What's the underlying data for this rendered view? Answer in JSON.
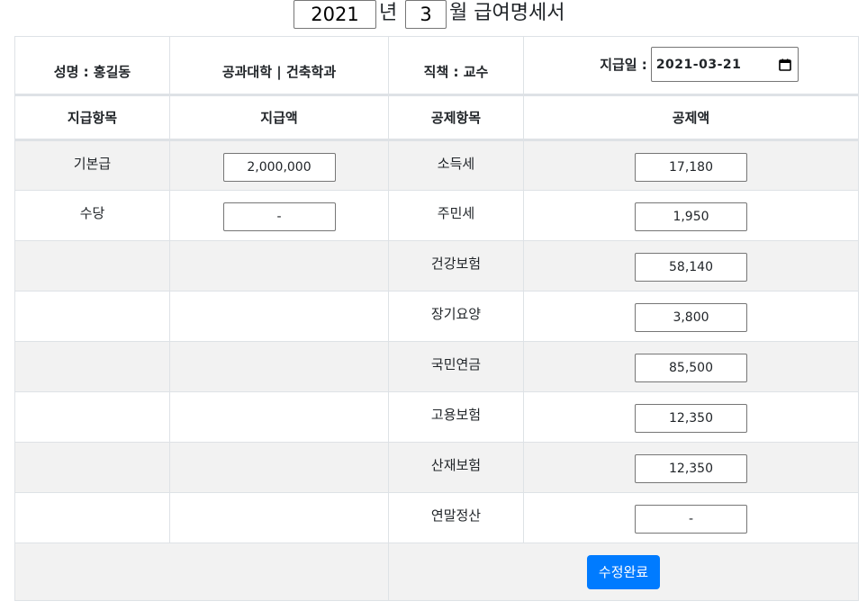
{
  "header": {
    "year_value": "2021",
    "year_suffix": "년",
    "month_value": "3",
    "month_suffix": "월 급여명세서"
  },
  "employee": {
    "name_label": "성명 : 홍길동",
    "department": "공과대학 | 건축학과",
    "position_label": "직책 : 교수",
    "pay_date_label": "지급일 :",
    "pay_date_value": "2021-03-21"
  },
  "columns": {
    "pay_item": "지급항목",
    "pay_amount": "지급액",
    "deduction_item": "공제항목",
    "deduction_amount": "공제액"
  },
  "rows": [
    {
      "pay_item": "기본급",
      "pay_amount": "2,000,000",
      "deduction_item": "소득세",
      "deduction_amount": "17,180"
    },
    {
      "pay_item": "수당",
      "pay_amount": "-",
      "deduction_item": "주민세",
      "deduction_amount": "1,950"
    },
    {
      "pay_item": "",
      "pay_amount": "",
      "deduction_item": "건강보험",
      "deduction_amount": "58,140"
    },
    {
      "pay_item": "",
      "pay_amount": "",
      "deduction_item": "장기요양",
      "deduction_amount": "3,800"
    },
    {
      "pay_item": "",
      "pay_amount": "",
      "deduction_item": "국민연금",
      "deduction_amount": "85,500"
    },
    {
      "pay_item": "",
      "pay_amount": "",
      "deduction_item": "고용보험",
      "deduction_amount": "12,350"
    },
    {
      "pay_item": "",
      "pay_amount": "",
      "deduction_item": "산재보험",
      "deduction_amount": "12,350"
    },
    {
      "pay_item": "",
      "pay_amount": "",
      "deduction_item": "연말정산",
      "deduction_amount": "-"
    }
  ],
  "footer": {
    "submit_label": "수정완료"
  },
  "colors": {
    "primary_button": "#007bff",
    "shaded_row": "#f2f2f2",
    "border": "#dee2e6"
  },
  "icons": {
    "date_picker": "calendar-icon"
  }
}
